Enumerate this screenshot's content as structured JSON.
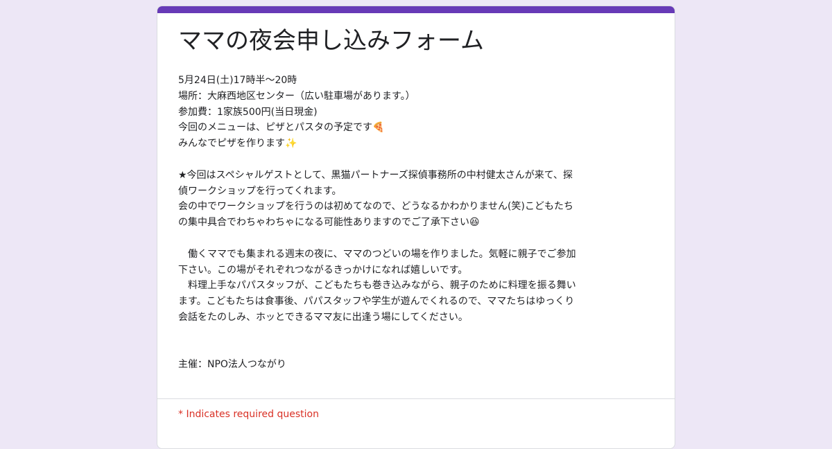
{
  "form": {
    "title": "ママの夜会申し込みフォーム",
    "accent_color": "#673ab7",
    "description": {
      "date_time": "5月24日(土)17時半～20時",
      "location": "場所：大麻西地区センター（広い駐車場があります。）",
      "fee": "参加費：1家族500円(当日現金)",
      "menu": "今回のメニューは、ピザとパスタの予定です🍕",
      "pizza": "みんなでピザを作ります✨",
      "guest_line1": "★今回はスペシャルゲストとして、黒猫パートナーズ探偵事務所の中村健太さんが来て、探",
      "guest_line2": "偵ワークショップを行ってくれます。",
      "workshop_line1": "会の中でワークショップを行うのは初めてなので、どうなるかわかりません(笑)こどもたち",
      "workshop_line2": "の集中具合でわちゃわちゃになる可能性ありますのでご了承下さい😆",
      "intro_line1": "　働くママでも集まれる週末の夜に、ママのつどいの場を作りました。気軽に親子でご参加",
      "intro_line2": "下さい。この場がそれぞれつながるきっかけになれば嬉しいです。",
      "intro_line3": "　料理上手なパパスタッフが、こどもたちも巻き込みながら、親子のために料理を振る舞い",
      "intro_line4": "ます。こどもたちは食事後、パパスタッフや学生が遊んでくれるので、ママたちはゆっくり",
      "intro_line5": "会話をたのしみ、ホッとできるママ友に出逢う場にしてください。",
      "organizer": "主催：NPO法人つながり"
    },
    "required_note": "* Indicates required question"
  }
}
